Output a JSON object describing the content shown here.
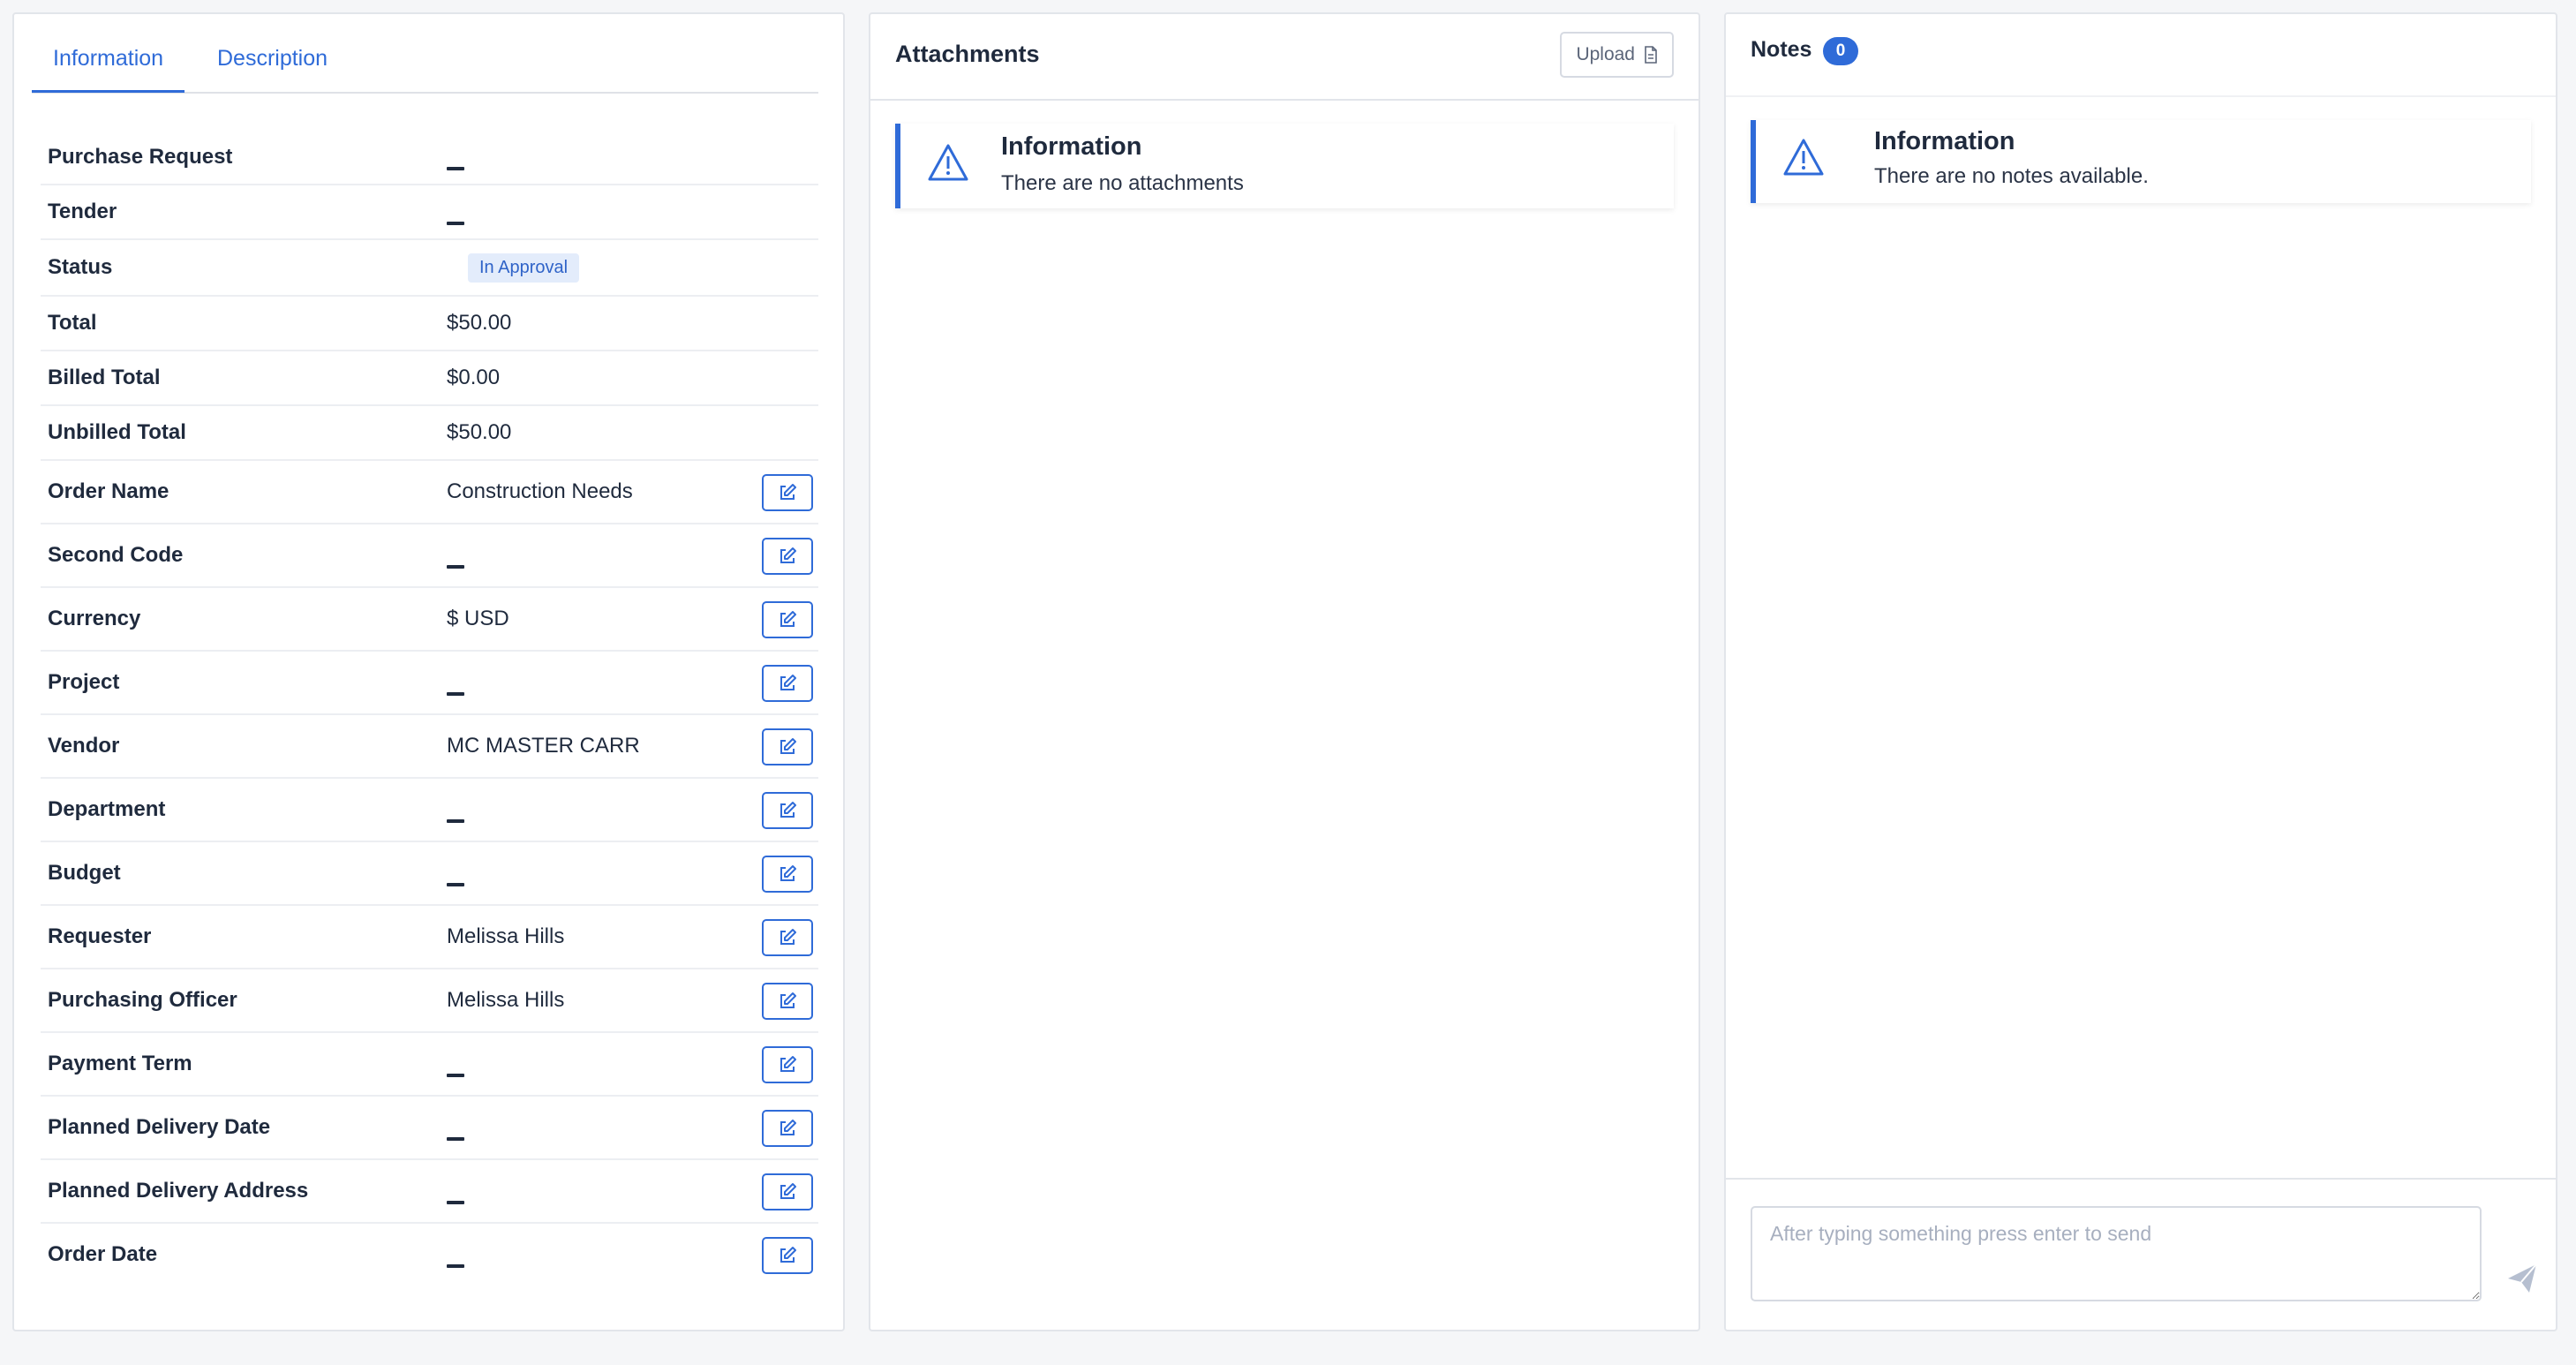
{
  "tabs": [
    "Information",
    "Description"
  ],
  "fields": [
    {
      "label": "Purchase Request",
      "value": "",
      "type": "dash",
      "editable": false
    },
    {
      "label": "Tender",
      "value": "",
      "type": "dash",
      "editable": false
    },
    {
      "label": "Status",
      "value": "In Approval",
      "type": "badge",
      "editable": false
    },
    {
      "label": "Total",
      "value": "$50.00",
      "type": "text",
      "editable": false
    },
    {
      "label": "Billed Total",
      "value": "$0.00",
      "type": "text",
      "editable": false
    },
    {
      "label": "Unbilled Total",
      "value": "$50.00",
      "type": "text",
      "editable": false
    },
    {
      "label": "Order Name",
      "value": "Construction Needs",
      "type": "text",
      "editable": true
    },
    {
      "label": "Second Code",
      "value": "",
      "type": "dash",
      "editable": true
    },
    {
      "label": "Currency",
      "value": "$ USD",
      "type": "text",
      "editable": true
    },
    {
      "label": "Project",
      "value": "",
      "type": "dash",
      "editable": true
    },
    {
      "label": "Vendor",
      "value": "MC MASTER CARR",
      "type": "text",
      "editable": true
    },
    {
      "label": "Department",
      "value": "",
      "type": "dash",
      "editable": true
    },
    {
      "label": "Budget",
      "value": "",
      "type": "dash",
      "editable": true
    },
    {
      "label": "Requester",
      "value": "Melissa Hills",
      "type": "text",
      "editable": true
    },
    {
      "label": "Purchasing Officer",
      "value": "Melissa Hills",
      "type": "text",
      "editable": true
    },
    {
      "label": "Payment Term",
      "value": "",
      "type": "dash",
      "editable": true
    },
    {
      "label": "Planned Delivery Date",
      "value": "",
      "type": "dash",
      "editable": true
    },
    {
      "label": "Planned Delivery Address",
      "value": "",
      "type": "dash",
      "editable": true
    },
    {
      "label": "Order Date",
      "value": "",
      "type": "dash",
      "editable": true
    }
  ],
  "attachments": {
    "title": "Attachments",
    "upload_label": "Upload",
    "alert_title": "Information",
    "alert_text": "There are no attachments"
  },
  "notes": {
    "title": "Notes",
    "count": "0",
    "alert_title": "Information",
    "alert_text": "There are no notes available.",
    "input_placeholder": "After typing something press enter to send"
  },
  "colors": {
    "accent": "#2f6bd8",
    "badge_bg": "#e3ecfb",
    "page_bg": "#f5f6f8"
  },
  "icons": {
    "edit": "edit-icon",
    "alert": "warning-triangle-icon",
    "upload": "file-icon",
    "send": "send-icon"
  }
}
